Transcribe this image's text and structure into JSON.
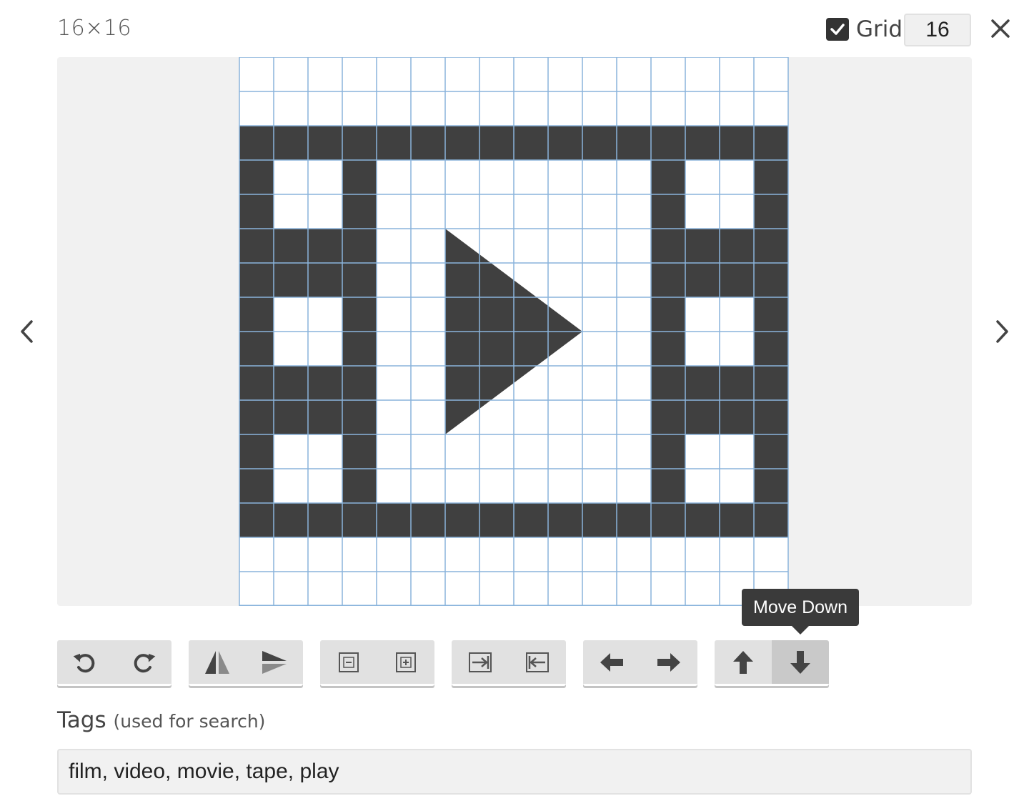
{
  "header": {
    "size_label": "16×16",
    "grid_label": "Grid",
    "grid_checked": true,
    "grid_size": "16"
  },
  "icons": {
    "close": "close-icon",
    "prev": "chevron-left-icon",
    "next": "chevron-right-icon",
    "checkbox": "checkmark-icon"
  },
  "canvas": {
    "cols": 16,
    "rows": 16,
    "grid_color": "#8ab4dc",
    "fill_color": "#404040",
    "background": "#ffffff",
    "filled_rows": [
      "................",
      "................",
      "################",
      "#..#........#..#",
      "#..#........#..#",
      "####........####",
      "####........####",
      "#..#........#..#",
      "#..#........#..#",
      "####........####",
      "####........####",
      "#..#........#..#",
      "#..#........#..#",
      "################",
      "................",
      "................"
    ],
    "play_triangle": [
      [
        6,
        5
      ],
      [
        6,
        11
      ],
      [
        10,
        8
      ]
    ]
  },
  "tooltip": {
    "text": "Move Down"
  },
  "toolbar": {
    "groups": [
      {
        "name": "rotate-group",
        "buttons": [
          {
            "name": "rotate-left-button",
            "icon": "rotate-ccw-icon"
          },
          {
            "name": "rotate-right-button",
            "icon": "rotate-cw-icon"
          }
        ]
      },
      {
        "name": "flip-group",
        "buttons": [
          {
            "name": "flip-horizontal-button",
            "icon": "flip-horizontal-icon"
          },
          {
            "name": "flip-vertical-button",
            "icon": "flip-vertical-icon"
          }
        ]
      },
      {
        "name": "zoom-group",
        "buttons": [
          {
            "name": "shrink-button",
            "icon": "box-minus-icon"
          },
          {
            "name": "grow-button",
            "icon": "box-plus-icon"
          }
        ]
      },
      {
        "name": "expand-group",
        "buttons": [
          {
            "name": "expand-right-button",
            "icon": "box-arrow-right-icon"
          },
          {
            "name": "contract-left-button",
            "icon": "box-arrow-left-icon"
          }
        ]
      },
      {
        "name": "move-horizontal-group",
        "buttons": [
          {
            "name": "move-left-button",
            "icon": "arrow-left-icon"
          },
          {
            "name": "move-right-button",
            "icon": "arrow-right-icon"
          }
        ]
      },
      {
        "name": "move-vertical-group",
        "buttons": [
          {
            "name": "move-up-button",
            "icon": "arrow-up-icon"
          },
          {
            "name": "move-down-button",
            "icon": "arrow-down-icon",
            "active": true
          }
        ]
      }
    ]
  },
  "tags": {
    "title": "Tags",
    "hint": "(used for search)",
    "value": "film, video, movie, tape, play"
  }
}
